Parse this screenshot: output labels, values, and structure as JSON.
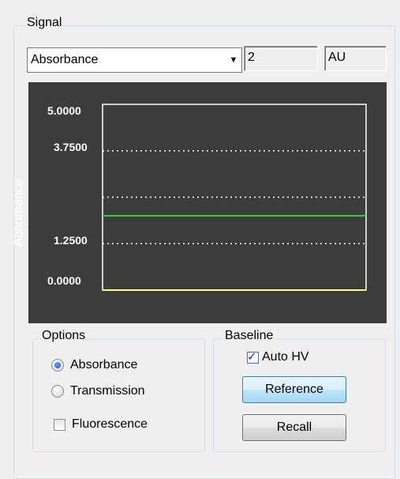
{
  "signal": {
    "group_label": "Signal",
    "mode_selected": "Absorbance",
    "channel_value": "2",
    "units_value": "AU"
  },
  "chart": {
    "ylabel": "Absorbance",
    "yticks": [
      "5.0000",
      "3.7500",
      "1.2500",
      "0.0000"
    ],
    "colors": {
      "background": "#3c3c3c",
      "frame": "#ffffff",
      "trace": "#3cc83c",
      "baseline": "#ffff80"
    }
  },
  "chart_data": {
    "type": "line",
    "title": "",
    "ylabel": "Absorbance",
    "xlabel": "",
    "ylim": [
      0,
      5.0
    ],
    "y_ticks": [
      0.0,
      1.25,
      2.5,
      3.75,
      5.0
    ],
    "y_tick_labels": [
      "5.0000",
      "3.7500",
      "1.2500",
      "0.0000"
    ],
    "grid": "horizontal dotted",
    "series": [
      {
        "values": [
          2.0,
          2.0
        ]
      }
    ],
    "baseline": 0.0
  },
  "options": {
    "group_label": "Options",
    "absorbance_label": "Absorbance",
    "transmission_label": "Transmission",
    "fluorescence_label": "Fluorescence",
    "selected": "Absorbance",
    "fluorescence_checked": false
  },
  "baseline": {
    "group_label": "Baseline",
    "auto_hv_label": "Auto HV",
    "auto_hv_checked": true,
    "reference_label": "Reference",
    "recall_label": "Recall"
  }
}
